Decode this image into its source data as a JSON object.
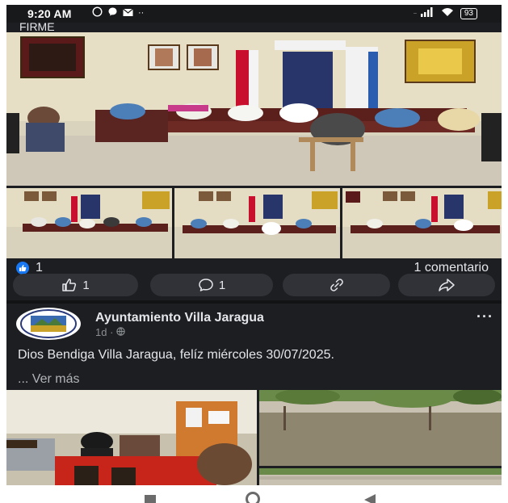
{
  "status_bar": {
    "time": "9:20 AM",
    "battery": "93"
  },
  "previous_post": {
    "cut_text": "FIRME"
  },
  "reactions": {
    "like_count": "1",
    "comment_count": "1 comentario"
  },
  "actions": {
    "like_label": "1",
    "comment_label": "1"
  },
  "post": {
    "page_name": "Ayuntamiento Villa Jaragua",
    "time_ago": "1d ·",
    "text": "Dios Bendiga Villa Jaragua, felíz miércoles 30/07/2025.",
    "see_more": "... Ver más"
  },
  "icons": {
    "status_left": [
      "whatsapp-icon",
      "messenger-icon",
      "mail-icon"
    ],
    "status_right": [
      "signal-icon",
      "wifi-icon",
      "battery-icon"
    ],
    "actions": [
      "like-icon",
      "comment-icon",
      "copy-link-icon",
      "share-icon"
    ],
    "navbar": [
      "recents-icon",
      "home-icon",
      "back-icon"
    ]
  },
  "colors": {
    "background": "#1c1e21",
    "text": "#e4e6eb",
    "muted": "#8a8d91",
    "like_blue": "#1877f2",
    "pill": "#303237"
  }
}
